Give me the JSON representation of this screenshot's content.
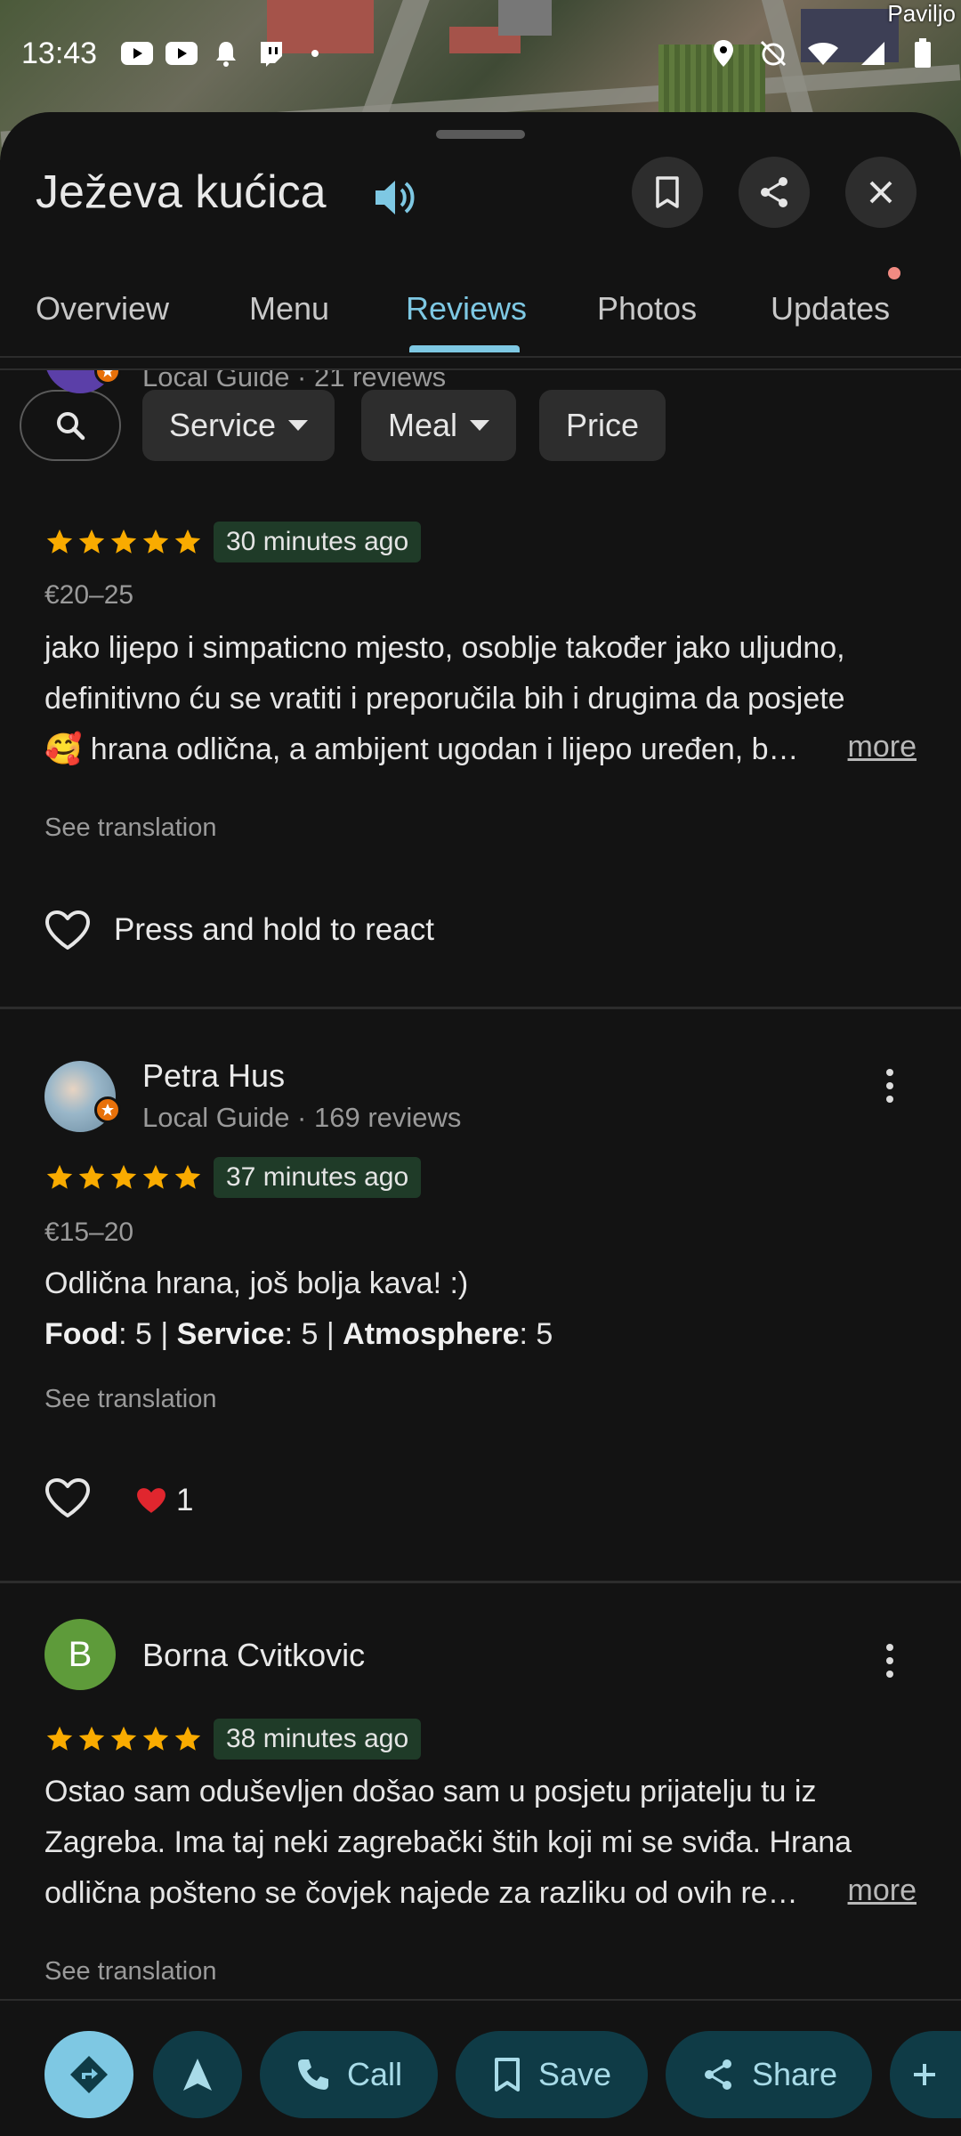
{
  "status_bar": {
    "time": "13:43",
    "map_label": "Paviljo"
  },
  "header": {
    "title": "Ježeva kućica"
  },
  "tabs": [
    {
      "label": "Overview"
    },
    {
      "label": "Menu"
    },
    {
      "label": "Reviews"
    },
    {
      "label": "Photos"
    },
    {
      "label": "Updates"
    }
  ],
  "active_tab": "Reviews",
  "filters": {
    "chips": [
      {
        "label": "Service"
      },
      {
        "label": "Meal"
      },
      {
        "label": "Price"
      }
    ]
  },
  "reviews": [
    {
      "meta": "Local Guide · 21 reviews",
      "rating": 5,
      "time_ago": "30 minutes ago",
      "price": "€20–25",
      "lines": [
        "jako lijepo i simpaticno mjesto, osoblje također jako uljudno,",
        "definitivno ću se vratiti i preporučila bih i drugima da posjete",
        "🥰 hrana odlična, a ambijent ugodan i lijepo uređen, b…"
      ],
      "more": "more",
      "see_translation": "See translation",
      "react_label": "Press and hold to react"
    },
    {
      "name": "Petra Hus",
      "meta": "Local Guide · 169 reviews",
      "rating": 5,
      "time_ago": "37 minutes ago",
      "price": "€15–20",
      "line1": "Odlična hrana, još bolja kava! :)",
      "aspects": {
        "food_label": "Food",
        "food_value": ": 5 | ",
        "service_label": "Service",
        "service_value": ": 5 | ",
        "atmosphere_label": "Atmosphere",
        "atmosphere_value": ": 5"
      },
      "see_translation": "See translation",
      "reaction_count": "1"
    },
    {
      "name": "Borna Cvitkovic",
      "initial": "B",
      "rating": 5,
      "time_ago": "38 minutes ago",
      "lines": [
        "Ostao sam oduševljen došao sam u posjetu prijatelju tu iz",
        "Zagreba. Ima taj neki zagrebački štih koji mi se sviđa. Hrana",
        "odlična pošteno se čovjek najede za razliku od ovih re…"
      ],
      "more": "more",
      "see_translation": "See translation"
    }
  ],
  "bottom_actions": [
    {
      "label": "Call"
    },
    {
      "label": "Save"
    },
    {
      "label": "Share"
    }
  ],
  "colors": {
    "accent": "#7ec8e3",
    "star": "#f9ab00",
    "time_chip": "#1f3b28"
  }
}
